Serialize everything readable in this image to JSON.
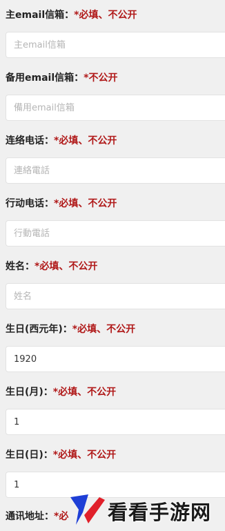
{
  "fields": [
    {
      "label": "主email信箱：",
      "note": "*必填、不公开",
      "placeholder": "主email信箱",
      "value": ""
    },
    {
      "label": "备用email信箱：",
      "note": "*不公开",
      "placeholder": "備用email信箱",
      "value": ""
    },
    {
      "label": "连络电话：",
      "note": "*必填、不公开",
      "placeholder": "連絡電話",
      "value": ""
    },
    {
      "label": "行动电话：",
      "note": "*必填、不公开",
      "placeholder": "行動電話",
      "value": ""
    },
    {
      "label": "姓名：",
      "note": "*必填、不公开",
      "placeholder": "姓名",
      "value": ""
    },
    {
      "label": "生日(西元年)：",
      "note": "*必填、不公开",
      "placeholder": "",
      "value": "1920"
    },
    {
      "label": "生日(月)：",
      "note": "*必填、不公开",
      "placeholder": "",
      "value": "1"
    },
    {
      "label": "生日(日)：",
      "note": "*必填、不公开",
      "placeholder": "",
      "value": "1"
    },
    {
      "label": "通讯地址：",
      "note": "*必"
    }
  ],
  "watermark": {
    "text": "看看手游网",
    "colors": {
      "logo_blue": "#1e3fd6",
      "logo_red": "#e0202a"
    }
  },
  "colors": {
    "required_note": "#b01818",
    "background": "#f0f0f0"
  }
}
